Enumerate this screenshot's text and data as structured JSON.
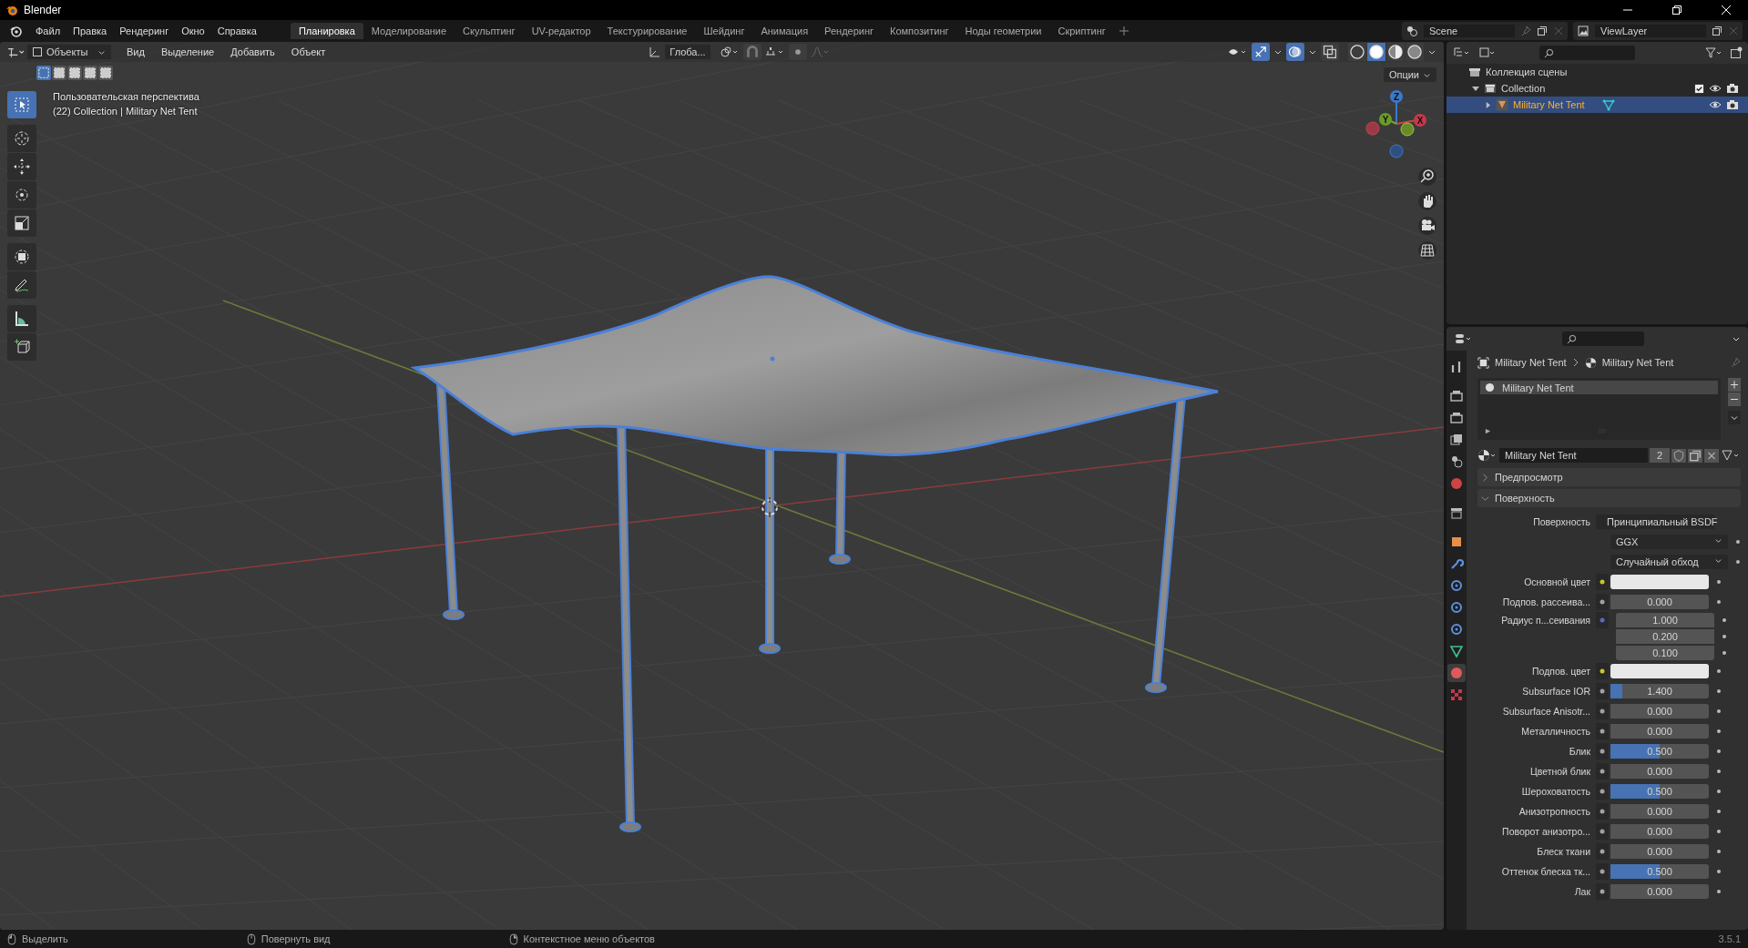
{
  "window": {
    "title": "Blender"
  },
  "menu": [
    "Файл",
    "Правка",
    "Рендеринг",
    "Окно",
    "Справка"
  ],
  "workspaces": [
    {
      "label": "Планировка",
      "selected": true
    },
    {
      "label": "Моделирование",
      "selected": false
    },
    {
      "label": "Скульптинг",
      "selected": false
    },
    {
      "label": "UV-редактор",
      "selected": false
    },
    {
      "label": "Текстурирование",
      "selected": false
    },
    {
      "label": "Шейдинг",
      "selected": false
    },
    {
      "label": "Анимация",
      "selected": false
    },
    {
      "label": "Рендеринг",
      "selected": false
    },
    {
      "label": "Композитинг",
      "selected": false
    },
    {
      "label": "Ноды геометрии",
      "selected": false
    },
    {
      "label": "Скриптинг",
      "selected": false
    }
  ],
  "scene": "Scene",
  "view_layer": "ViewLayer",
  "viewport": {
    "mode": "Объекты",
    "menus": [
      "Вид",
      "Выделение",
      "Добавить",
      "Объект"
    ],
    "orientation": "Глоба...",
    "options": "Опции",
    "select_modes": [
      {
        "selected": true
      },
      {
        "selected": false
      },
      {
        "selected": false
      },
      {
        "selected": false
      },
      {
        "selected": false
      }
    ],
    "tools": [
      {
        "kind": "select",
        "selected": true
      },
      {
        "kind": "cursor",
        "selected": false
      },
      {
        "kind": "move",
        "selected": false
      },
      {
        "kind": "rotate",
        "selected": false
      },
      {
        "kind": "scale",
        "selected": false
      },
      {
        "kind": "transform",
        "selected": false
      },
      {
        "kind": "annotate",
        "selected": false
      },
      {
        "kind": "measure",
        "selected": false
      },
      {
        "kind": "add-cube",
        "selected": false
      }
    ],
    "overlay_text": [
      "Пользовательская перспектива",
      "(22) Collection | Military Net Tent"
    ],
    "gizmo_axes": [
      "X",
      "Y",
      "Z"
    ],
    "shading": [
      {
        "selected": false
      },
      {
        "selected": true
      },
      {
        "selected": false
      },
      {
        "selected": false
      }
    ]
  },
  "outliner": {
    "root": "Коллекция сцены",
    "children": [
      {
        "name": "Collection",
        "expanded": true,
        "children": [
          {
            "name": "Military Net Tent",
            "expanded": false,
            "selected": true
          }
        ]
      }
    ]
  },
  "properties": {
    "tabs": [
      {
        "kind": "tool",
        "selected": false
      },
      {
        "kind": "render",
        "selected": false
      },
      {
        "kind": "output",
        "selected": false
      },
      {
        "kind": "view-layer",
        "selected": false
      },
      {
        "kind": "scene",
        "selected": false
      },
      {
        "kind": "world",
        "selected": false
      },
      {
        "kind": "collection",
        "selected": false
      },
      {
        "kind": "object",
        "selected": false
      },
      {
        "kind": "modifier",
        "selected": false
      },
      {
        "kind": "particles",
        "selected": false
      },
      {
        "kind": "physics",
        "selected": false
      },
      {
        "kind": "constraint",
        "selected": false
      },
      {
        "kind": "data",
        "selected": false
      },
      {
        "kind": "material",
        "selected": true
      },
      {
        "kind": "texture",
        "selected": false
      }
    ],
    "breadcrumb": [
      "Military Net Tent",
      "Military Net Tent"
    ],
    "slots": [
      {
        "name": "Military Net Tent",
        "selected": true
      }
    ],
    "material": {
      "name": "Military Net Tent",
      "users": "2"
    },
    "panels": [
      {
        "title": "Предпросмотр",
        "expanded": false
      },
      {
        "title": "Поверхность",
        "expanded": true
      }
    ],
    "surface": {
      "label": "Поверхность",
      "value": "Принципиальный BSDF"
    },
    "rows": [
      {
        "kind": "dropdown",
        "value": "GGX"
      },
      {
        "kind": "dropdown",
        "value": "Случайный обход"
      },
      {
        "kind": "color",
        "label": "Основной цвет",
        "color": "#e8e8e8"
      },
      {
        "kind": "value",
        "label": "Подпов. рассеива...",
        "value": "0.000",
        "level": 0
      },
      {
        "kind": "vector",
        "label": "Радиус п...сеивания",
        "values": [
          "1.000",
          "0.200",
          "0.100"
        ]
      },
      {
        "kind": "color",
        "label": "Подпов. цвет",
        "color": "#e8e8e8"
      },
      {
        "kind": "value",
        "label": "Subsurface IOR",
        "value": "1.400",
        "level": 0.12
      },
      {
        "kind": "value",
        "label": "Subsurface Anisotr...",
        "value": "0.000",
        "level": 0
      },
      {
        "kind": "value",
        "label": "Металличность",
        "value": "0.000",
        "level": 0
      },
      {
        "kind": "value",
        "label": "Блик",
        "value": "0.500",
        "level": 0.5
      },
      {
        "kind": "value",
        "label": "Цветной блик",
        "value": "0.000",
        "level": 0
      },
      {
        "kind": "value",
        "label": "Шероховатость",
        "value": "0.500",
        "level": 0.5
      },
      {
        "kind": "value",
        "label": "Анизотропность",
        "value": "0.000",
        "level": 0
      },
      {
        "kind": "value",
        "label": "Поворот анизотро...",
        "value": "0.000",
        "level": 0
      },
      {
        "kind": "value",
        "label": "Блеск ткани",
        "value": "0.000",
        "level": 0
      },
      {
        "kind": "value",
        "label": "Оттенок блеска тк...",
        "value": "0.500",
        "level": 0.5
      },
      {
        "kind": "value",
        "label": "Лак",
        "value": "0.000",
        "level": 0
      }
    ]
  },
  "status_bar": {
    "items": [
      "Выделить",
      "Повернуть вид",
      "Контекстное меню объектов"
    ],
    "version": "3.5.1"
  }
}
